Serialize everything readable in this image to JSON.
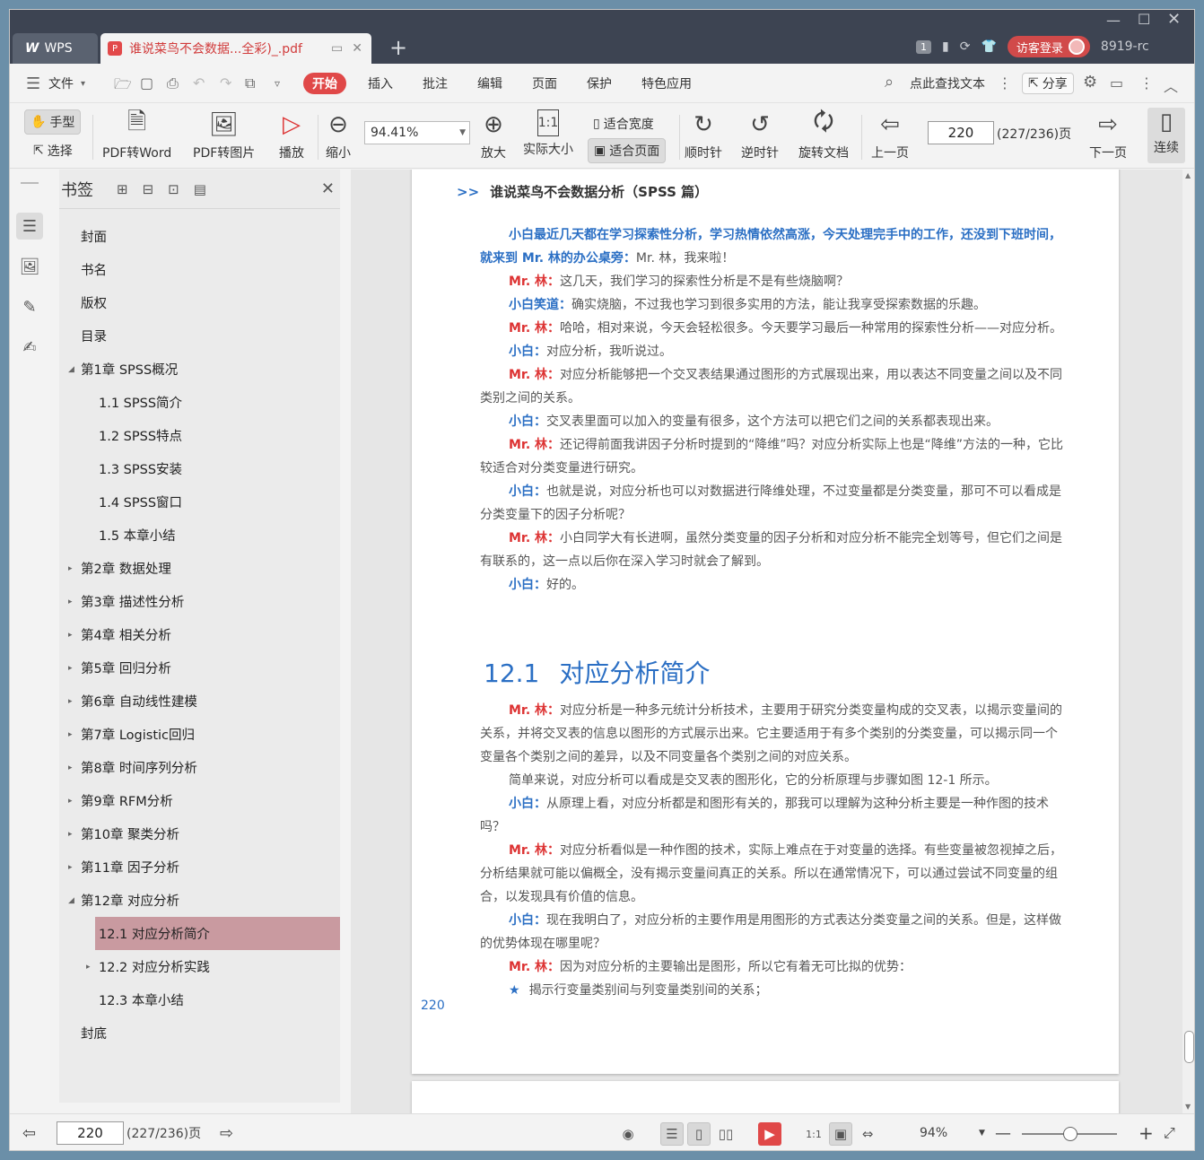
{
  "app": {
    "brand": "WPS",
    "tab_title": "谁说菜鸟不会数据...全彩)_.pdf",
    "counter": "1",
    "login": "访客登录",
    "user": "8919-rc"
  },
  "menu": {
    "file": "文件",
    "tabs": [
      "开始",
      "插入",
      "批注",
      "编辑",
      "页面",
      "保护",
      "特色应用"
    ],
    "search": "点此查找文本",
    "share": "分享"
  },
  "toolbar": {
    "hand": "手型",
    "select": "选择",
    "pdf2word": "PDF转Word",
    "pdf2img": "PDF转图片",
    "play": "播放",
    "zoom_out": "缩小",
    "zoom_value": "94.41%",
    "zoom_in": "放大",
    "actual_size": "实际大小",
    "fit_width": "适合宽度",
    "fit_page": "适合页面",
    "cw": "顺时针",
    "ccw": "逆时针",
    "rotate_doc": "旋转文档",
    "prev_page": "上一页",
    "page_value": "220",
    "page_total": "(227/236)页",
    "next_page": "下一页",
    "continuous": "连续"
  },
  "bookmarks": {
    "title": "书签",
    "items": [
      {
        "label": "封面",
        "level": 0,
        "arrow": ""
      },
      {
        "label": "书名",
        "level": 0,
        "arrow": ""
      },
      {
        "label": "版权",
        "level": 0,
        "arrow": ""
      },
      {
        "label": "目录",
        "level": 0,
        "arrow": ""
      },
      {
        "label": "第1章 SPSS概况",
        "level": 0,
        "arrow": "open"
      },
      {
        "label": "1.1 SPSS简介",
        "level": 1,
        "arrow": ""
      },
      {
        "label": "1.2 SPSS特点",
        "level": 1,
        "arrow": ""
      },
      {
        "label": "1.3 SPSS安装",
        "level": 1,
        "arrow": ""
      },
      {
        "label": "1.4 SPSS窗口",
        "level": 1,
        "arrow": ""
      },
      {
        "label": "1.5 本章小结",
        "level": 1,
        "arrow": ""
      },
      {
        "label": "第2章 数据处理",
        "level": 0,
        "arrow": "closed"
      },
      {
        "label": "第3章 描述性分析",
        "level": 0,
        "arrow": "closed"
      },
      {
        "label": "第4章 相关分析",
        "level": 0,
        "arrow": "closed"
      },
      {
        "label": "第5章 回归分析",
        "level": 0,
        "arrow": "closed"
      },
      {
        "label": "第6章 自动线性建模",
        "level": 0,
        "arrow": "closed"
      },
      {
        "label": "第7章 Logistic回归",
        "level": 0,
        "arrow": "closed"
      },
      {
        "label": "第8章 时间序列分析",
        "level": 0,
        "arrow": "closed"
      },
      {
        "label": "第9章 RFM分析",
        "level": 0,
        "arrow": "closed"
      },
      {
        "label": "第10章 聚类分析",
        "level": 0,
        "arrow": "closed"
      },
      {
        "label": "第11章 因子分析",
        "level": 0,
        "arrow": "closed"
      },
      {
        "label": "第12章 对应分析",
        "level": 0,
        "arrow": "open"
      },
      {
        "label": "12.1 对应分析简介",
        "level": 1,
        "arrow": "",
        "selected": true
      },
      {
        "label": "12.2 对应分析实践",
        "level": 1,
        "arrow": "closed"
      },
      {
        "label": "12.3 本章小结",
        "level": 1,
        "arrow": ""
      },
      {
        "label": "封底",
        "level": 0,
        "arrow": ""
      }
    ]
  },
  "document": {
    "running_head_mark": ">>",
    "running_head": "谁说菜鸟不会数据分析（SPSS 篇）",
    "intro": "小白最近几天都在学习探索性分析，学习热情依然高涨，今天处理完手中的工作，还没到下班时间，就来到 Mr. 林的办公桌旁：",
    "intro_tail": "Mr. 林，我来啦！",
    "dialog1": [
      {
        "speaker": "Mr. 林：",
        "color": "red",
        "text": "这几天，我们学习的探索性分析是不是有些烧脑啊？"
      },
      {
        "speaker": "小白笑道：",
        "color": "blue",
        "text": "确实烧脑，不过我也学习到很多实用的方法，能让我享受探索数据的乐趣。"
      },
      {
        "speaker": "Mr. 林：",
        "color": "red",
        "text": "哈哈，相对来说，今天会轻松很多。今天要学习最后一种常用的探索性分析——对应分析。"
      },
      {
        "speaker": "小白：",
        "color": "blue",
        "text": "对应分析，我听说过。"
      },
      {
        "speaker": "Mr. 林：",
        "color": "red",
        "text": "对应分析能够把一个交叉表结果通过图形的方式展现出来，用以表达不同变量之间以及不同类别之间的关系。"
      },
      {
        "speaker": "小白：",
        "color": "blue",
        "text": "交叉表里面可以加入的变量有很多，这个方法可以把它们之间的关系都表现出来。"
      },
      {
        "speaker": "Mr. 林：",
        "color": "red",
        "text": "还记得前面我讲因子分析时提到的“降维”吗？对应分析实际上也是“降维”方法的一种，它比较适合对分类变量进行研究。"
      },
      {
        "speaker": "小白：",
        "color": "blue",
        "text": "也就是说，对应分析也可以对数据进行降维处理，不过变量都是分类变量，那可不可以看成是分类变量下的因子分析呢？"
      },
      {
        "speaker": "Mr. 林：",
        "color": "red",
        "text": "小白同学大有长进啊，虽然分类变量的因子分析和对应分析不能完全划等号，但它们之间是有联系的，这一点以后你在深入学习时就会了解到。"
      },
      {
        "speaker": "小白：",
        "color": "blue",
        "text": "好的。"
      }
    ],
    "section_num": "12.1",
    "section_title": "对应分析简介",
    "dialog2": [
      {
        "speaker": "Mr. 林：",
        "color": "red",
        "text": "对应分析是一种多元统计分析技术，主要用于研究分类变量构成的交叉表，以揭示变量间的关系，并将交叉表的信息以图形的方式展示出来。它主要适用于有多个类别的分类变量，可以揭示同一个变量各个类别之间的差异，以及不同变量各个类别之间的对应关系。"
      },
      {
        "speaker": "",
        "color": "",
        "text": "简单来说，对应分析可以看成是交叉表的图形化，它的分析原理与步骤如图 12-1 所示。"
      },
      {
        "speaker": "小白：",
        "color": "blue",
        "text": "从原理上看，对应分析都是和图形有关的，那我可以理解为这种分析主要是一种作图的技术吗？"
      },
      {
        "speaker": "Mr. 林：",
        "color": "red",
        "text": "对应分析看似是一种作图的技术，实际上难点在于对变量的选择。有些变量被忽视掉之后，分析结果就可能以偏概全，没有揭示变量间真正的关系。所以在通常情况下，可以通过尝试不同变量的组合，以发现具有价值的信息。"
      },
      {
        "speaker": "小白：",
        "color": "blue",
        "text": "现在我明白了，对应分析的主要作用是用图形的方式表达分类变量之间的关系。但是，这样做的优势体现在哪里呢？"
      },
      {
        "speaker": "Mr. 林：",
        "color": "red",
        "text": "因为对应分析的主要输出是图形，所以它有着无可比拟的优势："
      }
    ],
    "star_item": "揭示行变量类别间与列变量类别间的关系；",
    "page_number": "220"
  },
  "status": {
    "page_value": "220",
    "page_total": "(227/236)页",
    "zoom": "94%"
  }
}
